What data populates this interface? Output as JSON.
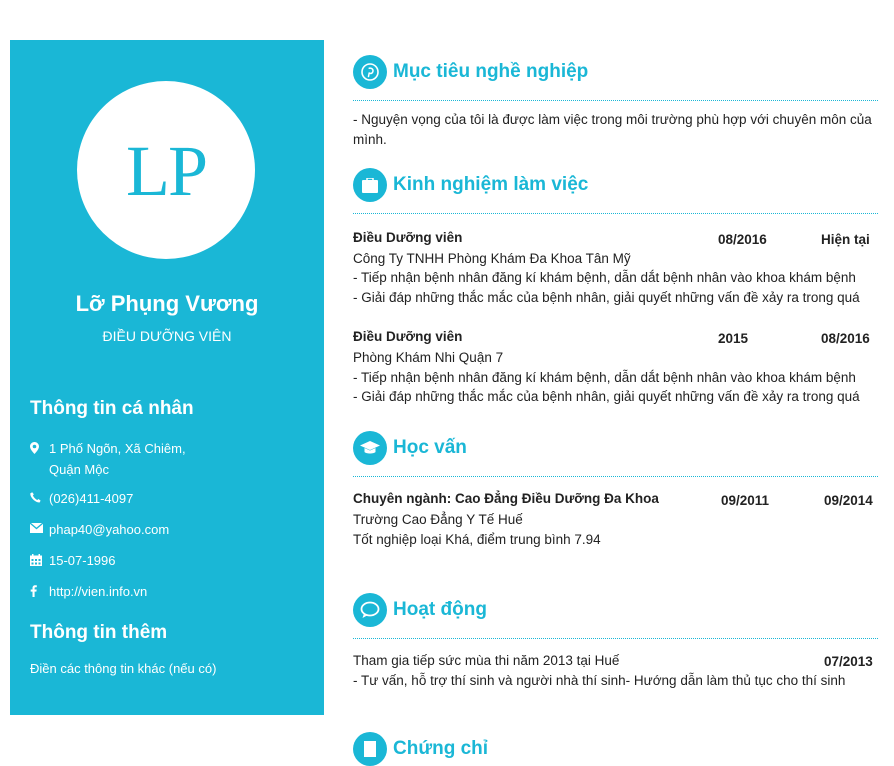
{
  "profile": {
    "initials": "LP",
    "name": "Lỡ Phụng Vương",
    "title": "ĐIỀU DƯỠNG VIÊN"
  },
  "personal": {
    "heading": "Thông tin cá nhân",
    "address_line1": "1 Phố Ngõn, Xã Chiêm,",
    "address_line2": "Quận Mộc",
    "phone": "(026)411-4097",
    "email": "phap40@yahoo.com",
    "birthday": "15-07-1996",
    "website": "http://vien.info.vn"
  },
  "extra": {
    "heading": "Thông tin thêm",
    "text": "Điền các thông tin khác (nếu có)"
  },
  "objective": {
    "title": "Mục tiêu nghề nghiệp",
    "text": "- Nguyện vọng của tôi là được làm việc trong môi trường phù hợp với chuyên môn của mình."
  },
  "experience": {
    "title": "Kinh nghiệm làm việc",
    "jobs": [
      {
        "position": "Điều Dưỡng viên",
        "start": "08/2016",
        "end": "Hiện tại",
        "company": "Công Ty TNHH Phòng Khám Đa Khoa Tân Mỹ",
        "duty1": "- Tiếp nhận bệnh nhân đăng kí khám bệnh, dẫn dắt bệnh nhân vào khoa khám bệnh",
        "duty2": "- Giải đáp những thắc mắc của bệnh nhân, giải quyết những vấn đề xảy ra trong quá"
      },
      {
        "position": "Điều Dưỡng viên",
        "start": "2015",
        "end": "08/2016",
        "company": "Phòng Khám Nhi Quận 7",
        "duty1": "- Tiếp nhận bệnh nhân đăng kí khám bệnh, dẫn dắt bệnh nhân vào khoa khám bệnh",
        "duty2": "- Giải đáp những thắc mắc của bệnh nhân, giải quyết những vấn đề xảy ra trong quá"
      }
    ]
  },
  "education": {
    "title": "Học vấn",
    "major": "Chuyên ngành: Cao Đẳng Điều Dưỡng Đa Khoa",
    "start": "09/2011",
    "end": "09/2014",
    "school": "Trường Cao Đẳng Y Tế Huế",
    "result": "Tốt nghiệp loại Khá, điểm trung bình 7.94"
  },
  "activities": {
    "title": "Hoạt động",
    "item": "Tham gia tiếp sức mùa thi năm 2013 tại Huế",
    "date": "07/2013",
    "detail": "- Tư vấn, hỗ trợ thí sinh và người nhà thí sinh- Hướng dẫn làm thủ tục cho thí sinh"
  },
  "certificates": {
    "title": "Chứng chỉ"
  },
  "colors": {
    "accent": "#1ab7d6",
    "text": "#222222"
  }
}
